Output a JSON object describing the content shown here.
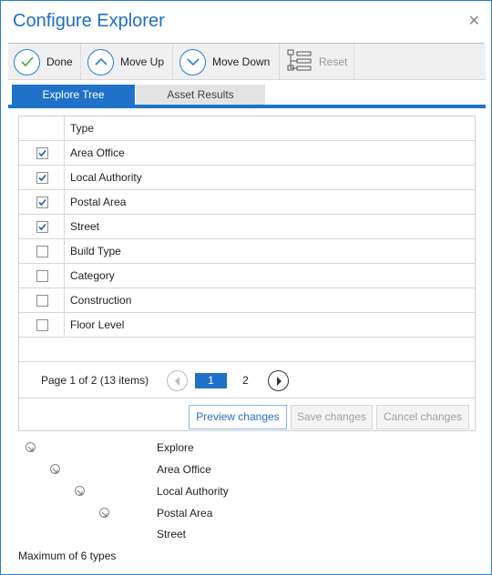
{
  "dialog": {
    "title": "Configure Explorer",
    "close_glyph": "✕"
  },
  "toolbar": {
    "done_label": "Done",
    "move_up_label": "Move Up",
    "move_down_label": "Move Down",
    "reset_label": "Reset"
  },
  "tabs": [
    {
      "label": "Explore Tree",
      "active": true
    },
    {
      "label": "Asset Results",
      "active": false
    }
  ],
  "grid": {
    "header": "Type",
    "rows": [
      {
        "label": "Area Office",
        "checked": true
      },
      {
        "label": "Local Authority",
        "checked": true
      },
      {
        "label": "Postal Area",
        "checked": true
      },
      {
        "label": "Street",
        "checked": true
      },
      {
        "label": "Build Type",
        "checked": false
      },
      {
        "label": "Category",
        "checked": false
      },
      {
        "label": "Construction",
        "checked": false
      },
      {
        "label": "Floor Level",
        "checked": false
      }
    ]
  },
  "pager": {
    "info": "Page 1 of 2 (13 items)",
    "page1": "1",
    "page2": "2"
  },
  "actions": {
    "preview_label": "Preview changes",
    "save_label": "Save changes",
    "cancel_label": "Cancel changes"
  },
  "tree": {
    "items": [
      "Explore",
      "Area Office",
      "Local Authority",
      "Postal Area",
      "Street"
    ]
  },
  "footer": "Maximum of 6 types",
  "colors": {
    "accent": "#1f72c8",
    "border": "#2b7cd3"
  }
}
